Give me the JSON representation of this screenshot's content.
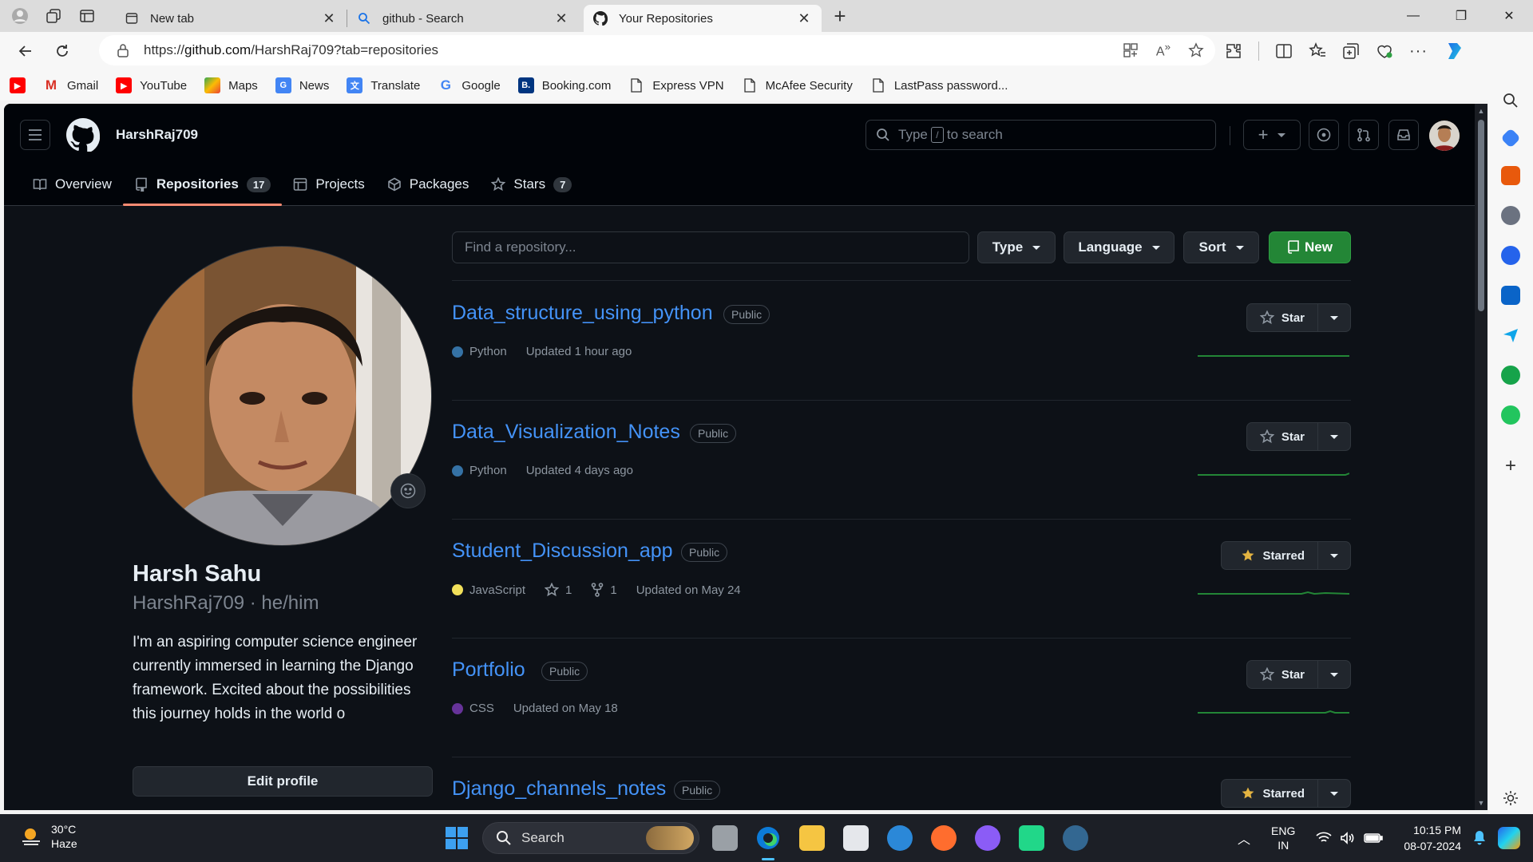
{
  "browser": {
    "tabs": [
      {
        "title": "New tab",
        "icon": "new-tab-icon",
        "active": false
      },
      {
        "title": "github - Search",
        "icon": "search-icon",
        "active": false
      },
      {
        "title": "Your Repositories",
        "icon": "github-icon",
        "active": true
      }
    ],
    "url_prefix": "https://",
    "url_host": "github.com",
    "url_rest": "/HarshRaj709?tab=repositories",
    "bookmarks": [
      {
        "label": "",
        "icon": "youtube-icon"
      },
      {
        "label": "Gmail",
        "icon": "gmail-icon"
      },
      {
        "label": "YouTube",
        "icon": "youtube-icon"
      },
      {
        "label": "Maps",
        "icon": "maps-icon"
      },
      {
        "label": "News",
        "icon": "news-icon"
      },
      {
        "label": "Translate",
        "icon": "translate-icon"
      },
      {
        "label": "Google",
        "icon": "google-icon"
      },
      {
        "label": "Booking.com",
        "icon": "booking-icon"
      },
      {
        "label": "Express VPN",
        "icon": "page-icon"
      },
      {
        "label": "McAfee Security",
        "icon": "page-icon"
      },
      {
        "label": "LastPass password...",
        "icon": "page-icon"
      }
    ]
  },
  "github": {
    "username": "HarshRaj709",
    "search_placeholder_pre": "Type",
    "search_key": "/",
    "search_placeholder_post": "to search",
    "nav": [
      {
        "label": "Overview",
        "icon": "book-icon",
        "count": null,
        "selected": false
      },
      {
        "label": "Repositories",
        "icon": "repo-icon",
        "count": "17",
        "selected": true
      },
      {
        "label": "Projects",
        "icon": "table-icon",
        "count": null,
        "selected": false
      },
      {
        "label": "Packages",
        "icon": "package-icon",
        "count": null,
        "selected": false
      },
      {
        "label": "Stars",
        "icon": "star-icon",
        "count": "7",
        "selected": false
      }
    ],
    "profile": {
      "name": "Harsh Sahu",
      "handle": "HarshRaj709 · he/him",
      "bio": "I'm an aspiring computer science engineer currently immersed in learning the Django framework. Excited about the possibilities this journey holds in the world o",
      "edit_label": "Edit profile"
    },
    "toolbar": {
      "find_placeholder": "Find a repository...",
      "type_label": "Type",
      "language_label": "Language",
      "sort_label": "Sort",
      "new_label": "New"
    },
    "repos": [
      {
        "name": "Data_structure_using_python",
        "visibility": "Public",
        "language": "Python",
        "lang_color": "#3572A5",
        "stars": null,
        "forks": null,
        "updated": "Updated 1 hour ago",
        "star_label": "Star",
        "starred": false
      },
      {
        "name": "Data_Visualization_Notes",
        "visibility": "Public",
        "language": "Python",
        "lang_color": "#3572A5",
        "stars": null,
        "forks": null,
        "updated": "Updated 4 days ago",
        "star_label": "Star",
        "starred": false
      },
      {
        "name": "Student_Discussion_app",
        "visibility": "Public",
        "language": "JavaScript",
        "lang_color": "#f1e05a",
        "stars": "1",
        "forks": "1",
        "updated": "Updated on May 24",
        "star_label": "Starred",
        "starred": true
      },
      {
        "name": "Portfolio",
        "visibility": "Public",
        "language": "CSS",
        "lang_color": "#663399",
        "stars": null,
        "forks": null,
        "updated": "Updated on May 18",
        "star_label": "Star",
        "starred": false
      },
      {
        "name": "Django_channels_notes",
        "visibility": "Public",
        "language": "",
        "lang_color": "",
        "stars": null,
        "forks": null,
        "updated": "",
        "star_label": "Starred",
        "starred": true
      }
    ]
  },
  "taskbar": {
    "temp": "30°C",
    "condition": "Haze",
    "search_label": "Search",
    "lang_top": "ENG",
    "lang_bottom": "IN",
    "time": "10:15 PM",
    "date": "08-07-2024"
  },
  "colors": {
    "gh_bg": "#0d1117",
    "gh_link": "#4493f8",
    "gh_green": "#238636",
    "tab_underline": "#fd8c73",
    "star_gold": "#e3b341"
  }
}
